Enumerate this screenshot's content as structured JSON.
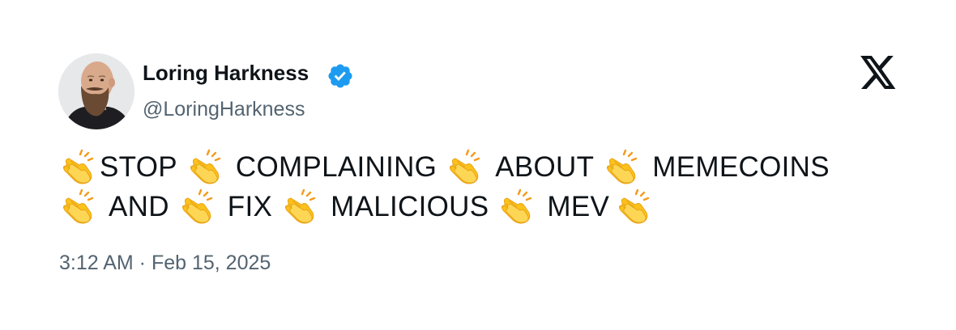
{
  "author": {
    "display_name": "Loring Harkness",
    "handle": "@LoringHarkness",
    "verified": true,
    "avatar_icon": "bearded-man-avatar"
  },
  "brand": {
    "logo_icon": "x-logo-icon",
    "color": "#0f1419"
  },
  "tweet": {
    "emoji_icon": "clapping-hands-icon",
    "line1": [
      "STOP",
      "COMPLAINING",
      "ABOUT",
      "MEMECOINS"
    ],
    "line2": [
      "AND",
      "FIX",
      "MALICIOUS",
      "MEV"
    ],
    "timestamp": "3:12 AM · Feb 15, 2025"
  },
  "colors": {
    "text": "#0f1419",
    "secondary": "#536471",
    "verified_blue": "#1d9bf0",
    "emoji_yellow": "#fcc21b"
  }
}
